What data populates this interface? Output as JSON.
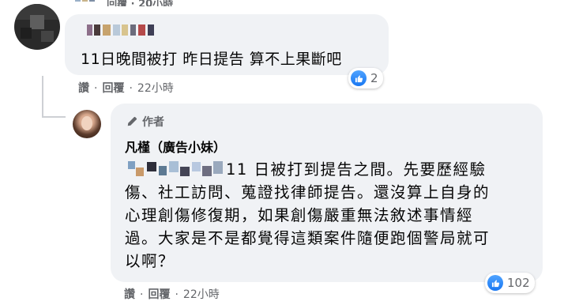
{
  "top_row": {
    "partial_text": "回覆 · 20小時"
  },
  "comment1": {
    "text": "11日晚間被打 昨日提告 算不上果斷吧",
    "reaction": {
      "icon": "like-icon",
      "count": "2"
    },
    "actions": {
      "like": "讚",
      "reply": "回覆",
      "time": "22小時"
    }
  },
  "reply": {
    "author_badge": "作者",
    "author_name": "凡槿（廣告小妹）",
    "lines": [
      "11 日被打到提告之間。先要歷經驗",
      "傷、社工訪問、蒐證找律師提告。還沒算上自身的",
      "心理創傷修復期，如果創傷嚴重無法敘述事情經",
      "過。大家是不是都覺得這類案件隨便跑個警局就可",
      "以啊？"
    ],
    "reaction": {
      "icon": "like-icon",
      "count": "102"
    },
    "actions": {
      "like": "讚",
      "reply": "回覆",
      "time": "22小時"
    }
  },
  "colors": {
    "bubble": "#f0f2f5",
    "secondary_text": "#65676b",
    "like_blue": "#1877f2"
  }
}
